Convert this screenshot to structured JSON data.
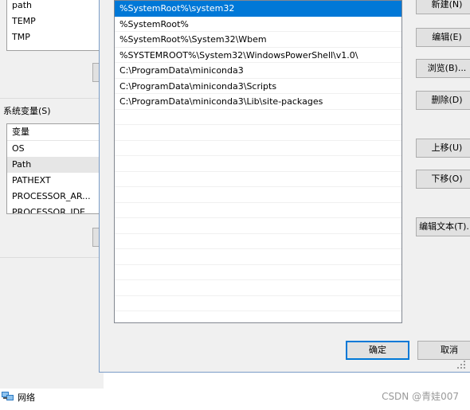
{
  "user_vars": {
    "items": [
      "path",
      "TEMP",
      "TMP"
    ]
  },
  "system_vars": {
    "group_label": "系统变量(S)",
    "header": "变量",
    "items": [
      "OS",
      "Path",
      "PATHEXT",
      "PROCESSOR_AR...",
      "PROCESSOR_IDE..."
    ],
    "selected": "Path"
  },
  "path_editor": {
    "entries": [
      "%SystemRoot%\\system32",
      "%SystemRoot%",
      "%SystemRoot%\\System32\\Wbem",
      "%SYSTEMROOT%\\System32\\WindowsPowerShell\\v1.0\\",
      "C:\\ProgramData\\miniconda3",
      "C:\\ProgramData\\miniconda3\\Scripts",
      "C:\\ProgramData\\miniconda3\\Lib\\site-packages"
    ],
    "selected_index": 0,
    "buttons": {
      "new": "新建(N)",
      "edit": "编辑(E)",
      "browse": "浏览(B)...",
      "delete": "删除(D)",
      "move_up": "上移(U)",
      "move_down": "下移(O)",
      "edit_text": "编辑文本(T)..."
    },
    "ok_label": "确定",
    "cancel_label": "取消"
  },
  "taskbar": {
    "network_label": "网络"
  },
  "watermark": "CSDN @青娃007",
  "colors": {
    "selection": "#0078d7",
    "dialog_bg": "#f0f0f0"
  }
}
